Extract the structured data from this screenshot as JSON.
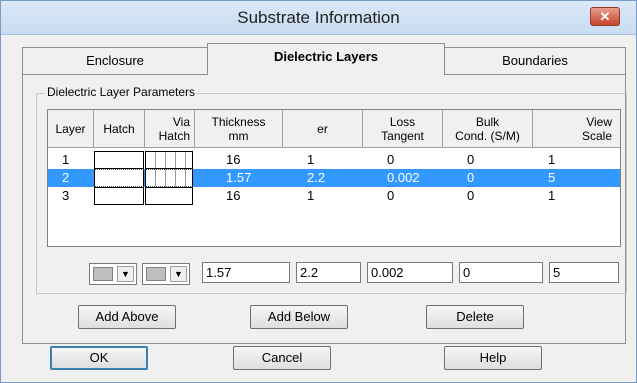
{
  "window": {
    "title": "Substrate Information",
    "close_label": "✕"
  },
  "tabs": [
    {
      "label": "Enclosure",
      "active": false
    },
    {
      "label": "Dielectric Layers",
      "active": true
    },
    {
      "label": "Boundaries",
      "active": false
    }
  ],
  "group": {
    "label": "Dielectric Layer Parameters"
  },
  "table": {
    "headers": {
      "layer": "Layer",
      "hatch": "Hatch",
      "via_hatch": [
        "Via",
        "Hatch"
      ],
      "thickness": [
        "Thickness",
        "mm"
      ],
      "er": "er",
      "loss": [
        "Loss",
        "Tangent"
      ],
      "bulk": [
        "Bulk",
        "Cond. (S/M)"
      ],
      "view": [
        "View",
        "Scale"
      ]
    },
    "rows": [
      {
        "layer": "1",
        "thickness": "16",
        "er": "1",
        "loss": "0",
        "bulk": "0",
        "view": "1",
        "selected": false
      },
      {
        "layer": "2",
        "thickness": "1.57",
        "er": "2.2",
        "loss": "0.002",
        "bulk": "0",
        "view": "5",
        "selected": true
      },
      {
        "layer": "3",
        "thickness": "16",
        "er": "1",
        "loss": "0",
        "bulk": "0",
        "view": "1",
        "selected": false
      }
    ]
  },
  "editors": {
    "thickness": "1.57",
    "er": "2.2",
    "loss": "0.002",
    "bulk": "0",
    "view": "5"
  },
  "buttons": {
    "add_above": "Add Above",
    "add_below": "Add Below",
    "delete": "Delete",
    "ok": "OK",
    "cancel": "Cancel",
    "help": "Help"
  },
  "colors": {
    "selection": "#3399ff",
    "title_bar": "#dbe8f7",
    "close": "#c7442a"
  },
  "icons": {
    "close": "close-icon",
    "combo_arrow": "chevron-down-icon"
  }
}
